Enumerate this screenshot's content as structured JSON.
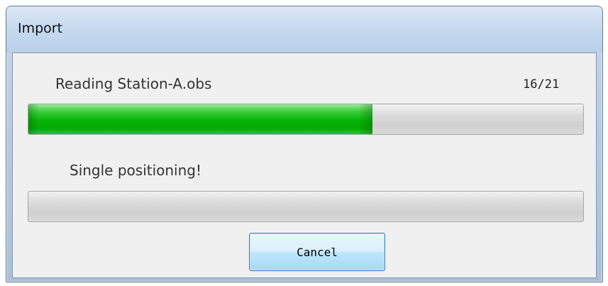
{
  "window": {
    "title": "Import"
  },
  "file_progress": {
    "label": "Reading Station-A.obs",
    "counter": "16/21",
    "fraction": 0.62
  },
  "position_progress": {
    "label": "Single positioning!",
    "fraction": 0.0
  },
  "buttons": {
    "cancel_label": "Cancel"
  },
  "colors": {
    "progress_fill": "#06b306",
    "window_frame": "#b6cbe4",
    "client_bg": "#f0f0f0"
  }
}
